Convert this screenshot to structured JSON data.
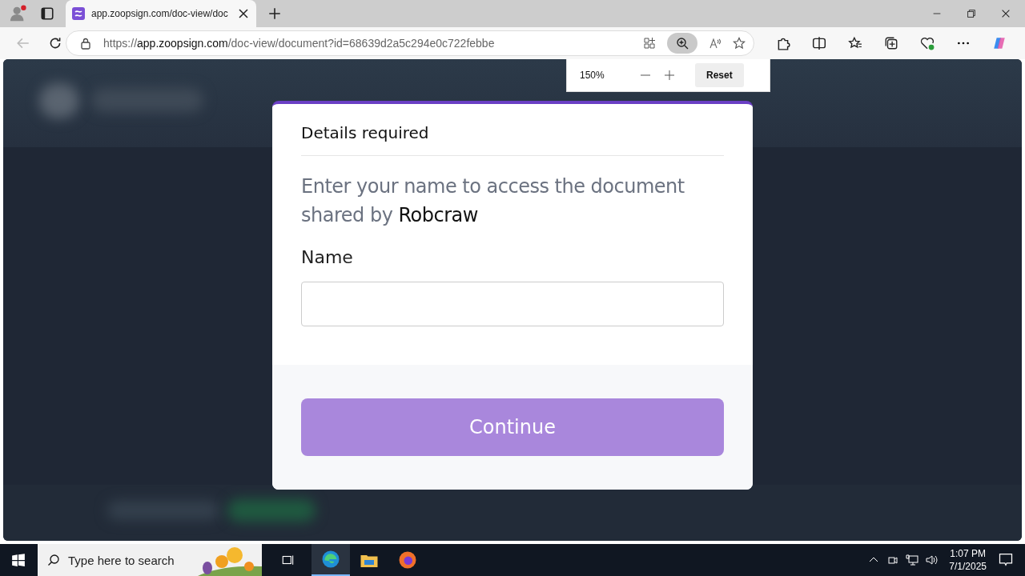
{
  "browser": {
    "tab_title": "app.zoopsign.com/doc-view/doc",
    "url_scheme": "https://",
    "url_host": "app.zoopsign.com",
    "url_path": "/doc-view/document?id=68639d2a5c294e0c722febbe",
    "zoom_popup": {
      "level": "150%",
      "reset": "Reset"
    }
  },
  "dialog": {
    "title": "Details required",
    "message": "Enter your name to access the document shared by",
    "sharer": "Robcraw",
    "field_label": "Name",
    "button": "Continue"
  },
  "taskbar": {
    "search_placeholder": "Type here to search",
    "time": "1:07 PM",
    "date": "7/1/2025"
  }
}
